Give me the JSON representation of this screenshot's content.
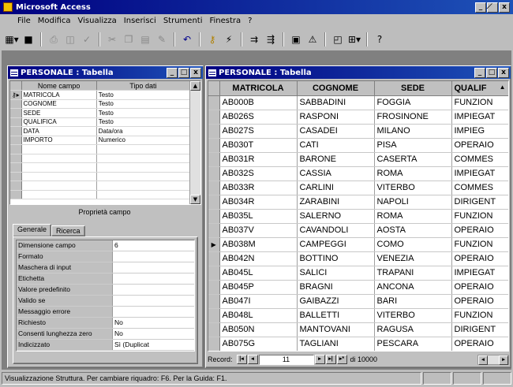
{
  "app": {
    "title": "Microsoft Access",
    "win_controls": [
      "_",
      "̸",
      "x"
    ]
  },
  "menu": [
    "File",
    "Modifica",
    "Visualizza",
    "Inserisci",
    "Strumenti",
    "Finestra",
    "?"
  ],
  "toolbar": {
    "icons": [
      "table-view-icon",
      "save-icon",
      "print-icon",
      "print-preview-icon",
      "spelling-icon",
      "cut-icon",
      "copy-icon",
      "paste-icon",
      "format-painter-icon",
      "undo-icon",
      "primary-key-icon",
      "indexes-icon",
      "insert-row-icon",
      "delete-row-icon",
      "properties-icon",
      "build-icon",
      "database-window-icon",
      "new-object-icon",
      "help-icon"
    ]
  },
  "design": {
    "title": "PERSONALE : Tabella",
    "col_headers": [
      "Nome campo",
      "Tipo dati"
    ],
    "fields": [
      {
        "name": "MATRICOLA",
        "type": "Testo"
      },
      {
        "name": "COGNOME",
        "type": "Testo"
      },
      {
        "name": "SEDE",
        "type": "Testo"
      },
      {
        "name": "QUALIFICA",
        "type": "Testo"
      },
      {
        "name": "DATA",
        "type": "Data/ora"
      },
      {
        "name": "IMPORTO",
        "type": "Numerico"
      },
      {
        "name": "",
        "type": ""
      },
      {
        "name": "",
        "type": ""
      },
      {
        "name": "",
        "type": ""
      },
      {
        "name": "",
        "type": ""
      },
      {
        "name": "",
        "type": ""
      },
      {
        "name": "",
        "type": ""
      }
    ],
    "properties_title": "Proprietà campo",
    "tabs": [
      "Generale",
      "Ricerca"
    ],
    "props": [
      {
        "label": "Dimensione campo",
        "value": "6"
      },
      {
        "label": "Formato",
        "value": ""
      },
      {
        "label": "Maschera di input",
        "value": ""
      },
      {
        "label": "Etichetta",
        "value": ""
      },
      {
        "label": "Valore predefinito",
        "value": ""
      },
      {
        "label": "Valido se",
        "value": ""
      },
      {
        "label": "Messaggio errore",
        "value": ""
      },
      {
        "label": "Richiesto",
        "value": "No"
      },
      {
        "label": "Consenti lunghezza zero",
        "value": "No"
      },
      {
        "label": "Indicizzato",
        "value": "Sì (Duplicat"
      }
    ]
  },
  "datasheet": {
    "title": "PERSONALE : Tabella",
    "columns": [
      "MATRICOLA",
      "COGNOME",
      "SEDE",
      "QUALIF"
    ],
    "rows": [
      [
        "AB000B",
        "SABBADINI",
        "FOGGIA",
        "FUNZION"
      ],
      [
        "AB026S",
        "RASPONI",
        "FROSINONE",
        "IMPIEGAT"
      ],
      [
        "AB027S",
        "CASADEI",
        "MILANO",
        "IMPIEG"
      ],
      [
        "AB030T",
        "CATI",
        "PISA",
        "OPERAIO"
      ],
      [
        "AB031R",
        "BARONE",
        "CASERTA",
        "COMMES"
      ],
      [
        "AB032S",
        "CASSIA",
        "ROMA",
        "IMPIEGAT"
      ],
      [
        "AB033R",
        "CARLINI",
        "VITERBO",
        "COMMES"
      ],
      [
        "AB034R",
        "ZARABINI",
        "NAPOLI",
        "DIRIGENT"
      ],
      [
        "AB035L",
        "SALERNO",
        "ROMA",
        "FUNZION"
      ],
      [
        "AB037V",
        "CAVANDOLI",
        "AOSTA",
        "OPERAIO"
      ],
      [
        "AB038M",
        "CAMPEGGI",
        "COMO",
        "FUNZION"
      ],
      [
        "AB042N",
        "BOTTINO",
        "VENEZIA",
        "OPERAIO"
      ],
      [
        "AB045L",
        "SALICI",
        "TRAPANI",
        "IMPIEGAT"
      ],
      [
        "AB045P",
        "BRAGNI",
        "ANCONA",
        "OPERAIO"
      ],
      [
        "AB047I",
        "GAIBAZZI",
        "BARI",
        "OPERAIO"
      ],
      [
        "AB048L",
        "BALLETTI",
        "VITERBO",
        "FUNZION"
      ],
      [
        "AB050N",
        "MANTOVANI",
        "RAGUSA",
        "DIRIGENT"
      ],
      [
        "AB075G",
        "TAGLIANI",
        "PESCARA",
        "OPERAIO"
      ]
    ],
    "current_row": 10,
    "nav": {
      "label": "Record:",
      "current": "11",
      "total": "di 10000"
    }
  },
  "status": "Visualizzazione Struttura. Per cambiare riquadro: F6. Per la Guida: F1."
}
